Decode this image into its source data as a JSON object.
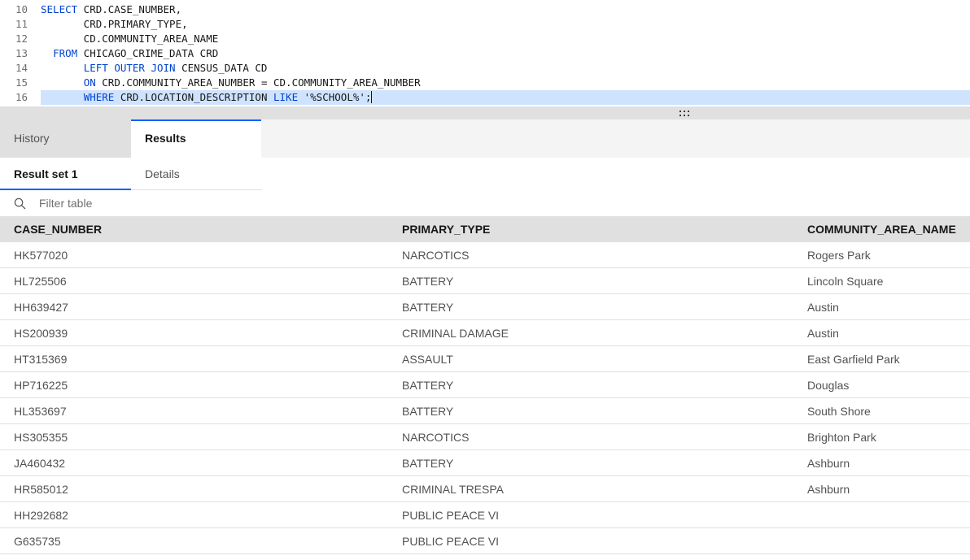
{
  "editor": {
    "lines": [
      {
        "num": "10",
        "tokens": [
          {
            "t": "SELECT",
            "k": true
          },
          {
            "t": " CRD.CASE_NUMBER,",
            "k": false
          }
        ]
      },
      {
        "num": "11",
        "tokens": [
          {
            "t": "       CRD.PRIMARY_TYPE,",
            "k": false
          }
        ]
      },
      {
        "num": "12",
        "tokens": [
          {
            "t": "       CD.COMMUNITY_AREA_NAME",
            "k": false
          }
        ]
      },
      {
        "num": "13",
        "tokens": [
          {
            "t": "  ",
            "k": false
          },
          {
            "t": "FROM",
            "k": true
          },
          {
            "t": " CHICAGO_CRIME_DATA CRD",
            "k": false
          }
        ]
      },
      {
        "num": "14",
        "tokens": [
          {
            "t": "       ",
            "k": false
          },
          {
            "t": "LEFT OUTER JOIN",
            "k": true
          },
          {
            "t": " CENSUS_DATA CD",
            "k": false
          }
        ]
      },
      {
        "num": "15",
        "tokens": [
          {
            "t": "       ",
            "k": false
          },
          {
            "t": "ON",
            "k": true
          },
          {
            "t": " CRD.COMMUNITY_AREA_NUMBER = CD.COMMUNITY_AREA_NUMBER",
            "k": false
          }
        ]
      },
      {
        "num": "16",
        "tokens": [
          {
            "t": "       ",
            "k": false
          },
          {
            "t": "WHERE",
            "k": true
          },
          {
            "t": " CRD.LOCATION_DESCRIPTION ",
            "k": false
          },
          {
            "t": "LIKE",
            "k": true
          },
          {
            "t": " '%SCHOOL%';",
            "k": false
          }
        ]
      }
    ],
    "active_line": 6
  },
  "tabs": {
    "history": "History",
    "results": "Results"
  },
  "subtabs": {
    "result_set": "Result set 1",
    "details": "Details"
  },
  "filter": {
    "placeholder": "Filter table"
  },
  "table": {
    "columns": [
      "CASE_NUMBER",
      "PRIMARY_TYPE",
      "COMMUNITY_AREA_NAME"
    ],
    "rows": [
      [
        "HK577020",
        "NARCOTICS",
        "Rogers Park"
      ],
      [
        "HL725506",
        "BATTERY",
        "Lincoln Square"
      ],
      [
        "HH639427",
        "BATTERY",
        "Austin"
      ],
      [
        "HS200939",
        "CRIMINAL DAMAGE",
        "Austin"
      ],
      [
        "HT315369",
        "ASSAULT",
        "East Garfield Park"
      ],
      [
        "HP716225",
        "BATTERY",
        "Douglas"
      ],
      [
        "HL353697",
        "BATTERY",
        "South Shore"
      ],
      [
        "HS305355",
        "NARCOTICS",
        "Brighton Park"
      ],
      [
        "JA460432",
        "BATTERY",
        "Ashburn"
      ],
      [
        "HR585012",
        "CRIMINAL TRESPA",
        "Ashburn"
      ],
      [
        "HH292682",
        "PUBLIC PEACE VI",
        ""
      ],
      [
        "G635735",
        "PUBLIC PEACE VI",
        ""
      ]
    ]
  },
  "colors": {
    "accent": "#0f62fe",
    "keyword": "#0043ce",
    "active_line": "#cfe3ff"
  }
}
